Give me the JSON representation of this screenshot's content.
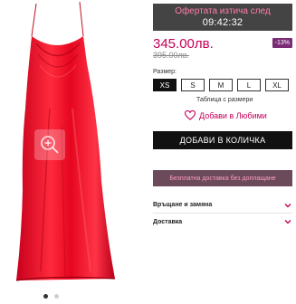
{
  "gallery": {
    "image_alt": "red satin slip dress",
    "zoom_icon": "zoom-in-icon",
    "dots_count": 2,
    "active_dot": 0
  },
  "timer": {
    "label": "Офертата изтича след",
    "time": "09:42:32"
  },
  "price": {
    "current": "345.00лв.",
    "old": "395.00лв.",
    "discount": "-13%"
  },
  "sizes": {
    "label": "Размер:",
    "options": [
      "XS",
      "S",
      "M",
      "L",
      "XL"
    ],
    "selected": "XS",
    "table_link": "Таблица с размери"
  },
  "wishlist": {
    "label": "Добави в Любими",
    "icon": "heart-icon"
  },
  "cart": {
    "label": "ДОБАВИ В КОЛИЧКА"
  },
  "promo": {
    "label": "Безплатна доставка без доплащане"
  },
  "accordion": [
    {
      "label": "Връщане и замяна"
    },
    {
      "label": "Доставка"
    }
  ],
  "colors": {
    "accent": "#c6005a",
    "timer_bg": "#444444",
    "button_bg": "#111111",
    "dress": "#e0102a"
  }
}
